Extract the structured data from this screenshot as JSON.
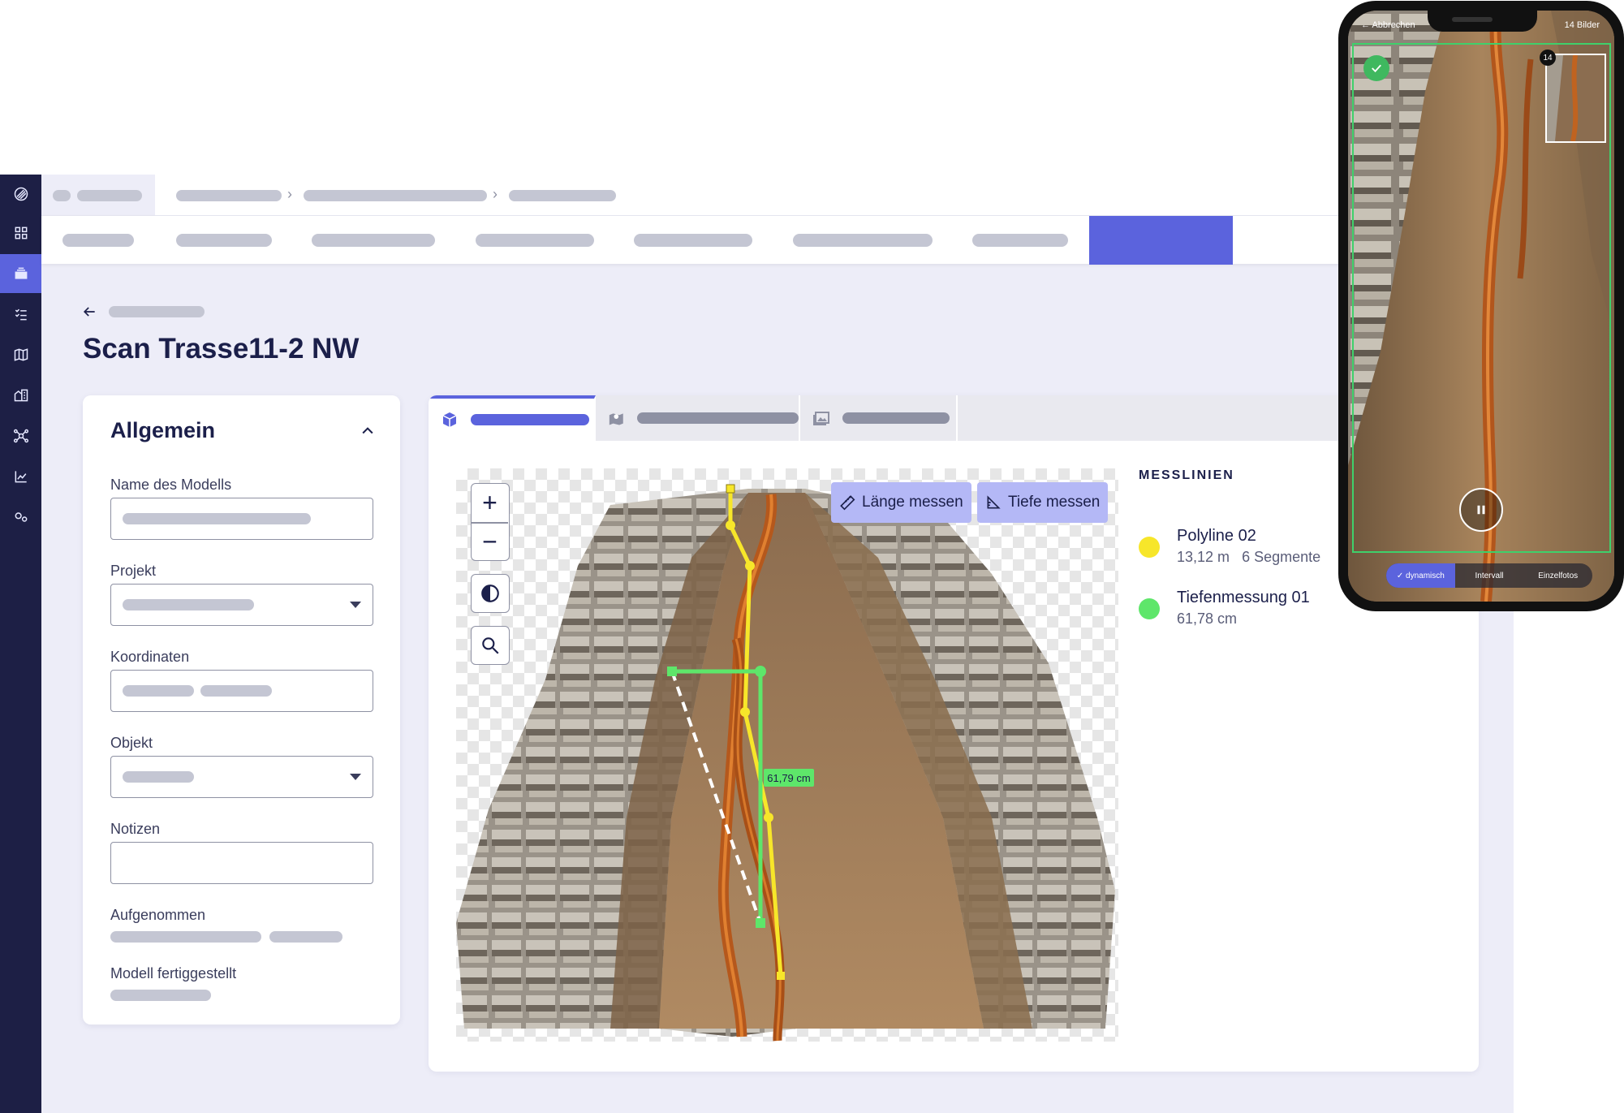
{
  "page": {
    "title": "Scan Trasse11-2 NW"
  },
  "colors": {
    "accent": "#5b63dd",
    "sidebar": "#1d1f45",
    "yellow_line": "#f7e62a",
    "green_line": "#5ee66a"
  },
  "sidebar": {
    "items": [
      {
        "icon": "logo-icon"
      },
      {
        "icon": "dashboard-icon"
      },
      {
        "icon": "layers-icon",
        "active": true
      },
      {
        "icon": "checklist-icon"
      },
      {
        "icon": "map-icon"
      },
      {
        "icon": "buildings-icon"
      },
      {
        "icon": "network-icon"
      },
      {
        "icon": "chart-icon"
      },
      {
        "icon": "settings-icon"
      }
    ]
  },
  "general": {
    "title": "Allgemein",
    "fields": {
      "model_name": "Name des Modells",
      "project": "Projekt",
      "coordinates": "Koordinaten",
      "object": "Objekt",
      "notes": "Notizen",
      "recorded": "Aufgenommen",
      "completed": "Modell fertiggestellt"
    }
  },
  "viewer": {
    "buttons": {
      "measure_length": "Länge messen",
      "measure_depth": "Tiefe messen"
    },
    "depth_label": "61,79 cm"
  },
  "measurements": {
    "title": "MESSLINIEN",
    "items": [
      {
        "name": "Polyline 02",
        "value": "13,12 m",
        "segments": "6 Segmente",
        "color": "#f7e62a"
      },
      {
        "name": "Tiefenmessung 01",
        "value": "61,78 cm",
        "segments": "",
        "color": "#5ee66a"
      }
    ]
  },
  "phone": {
    "cancel": "Abbrechen",
    "count": "14 Bilder",
    "badge": "14",
    "modes": [
      "dynamisch",
      "Intervall",
      "Einzelfotos"
    ]
  }
}
